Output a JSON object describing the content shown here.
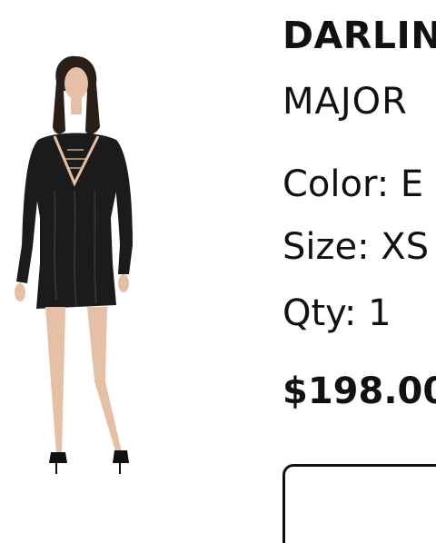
{
  "product": {
    "title": "DARLIN",
    "brand": "MAJOR",
    "color": "Color: E",
    "size": "Size: XS",
    "qty": "Qty: 1",
    "price": "$198.00"
  },
  "colors": {
    "text": "#111111",
    "dress": "#1b1b1b",
    "skin": "#e6c0a6"
  }
}
